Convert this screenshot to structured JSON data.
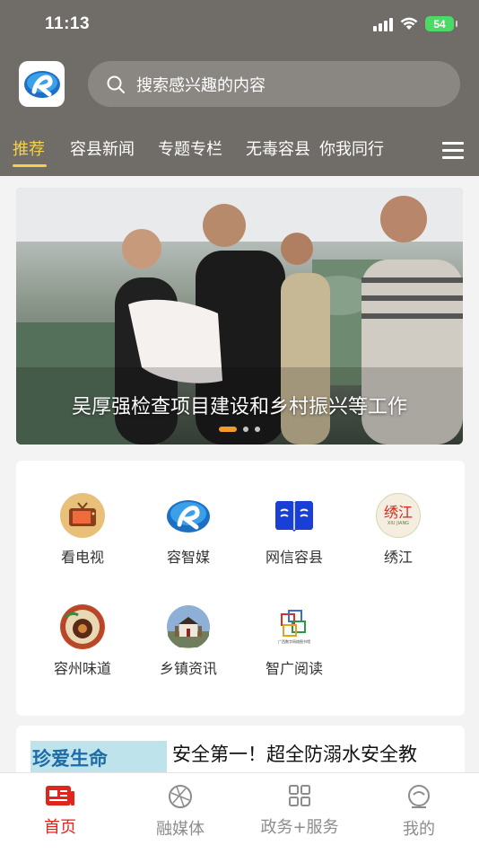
{
  "status_bar": {
    "time": "11:13",
    "battery": "54"
  },
  "search": {
    "placeholder": "搜索感兴趣的内容"
  },
  "tabs": [
    {
      "label": "推荐",
      "active": true
    },
    {
      "label": "容县新闻"
    },
    {
      "label": "专题专栏"
    },
    {
      "label": "无毒容县"
    },
    {
      "label": "你我同行"
    }
  ],
  "banner": {
    "caption": "吴厚强检查项目建设和乡村振兴等工作",
    "slide_count": 3,
    "active_slide": 1
  },
  "quick_links": [
    {
      "label": "看电视",
      "icon": "tv-icon"
    },
    {
      "label": "容智媒",
      "icon": "rongzhimei-logo-icon"
    },
    {
      "label": "网信容县",
      "icon": "book-icon"
    },
    {
      "label": "绣江",
      "icon": "xiujiang-icon",
      "icon_text": "绣江",
      "icon_subtext": "XIU JIANG"
    },
    {
      "label": "容州味道",
      "icon": "food-icon"
    },
    {
      "label": "乡镇资讯",
      "icon": "building-icon"
    },
    {
      "label": "智广阅读",
      "icon": "reading-logo-icon",
      "icon_caption": "广西数字网络图书馆"
    }
  ],
  "news": {
    "title": "安全第一！超全防溺水安全教",
    "thumb_text": "珍爱生命"
  },
  "bottom_nav": [
    {
      "label": "首页",
      "icon": "newspaper-icon",
      "active": true
    },
    {
      "label": "融媒体",
      "icon": "globe-icon"
    },
    {
      "label": "政务+服务",
      "icon": "grid-icon"
    },
    {
      "label": "我的",
      "icon": "user-icon"
    }
  ],
  "colors": {
    "header_bg": "#706c68",
    "tab_active": "#f3d24a",
    "nav_active": "#e0251b",
    "dot_active": "#f19b2c"
  }
}
